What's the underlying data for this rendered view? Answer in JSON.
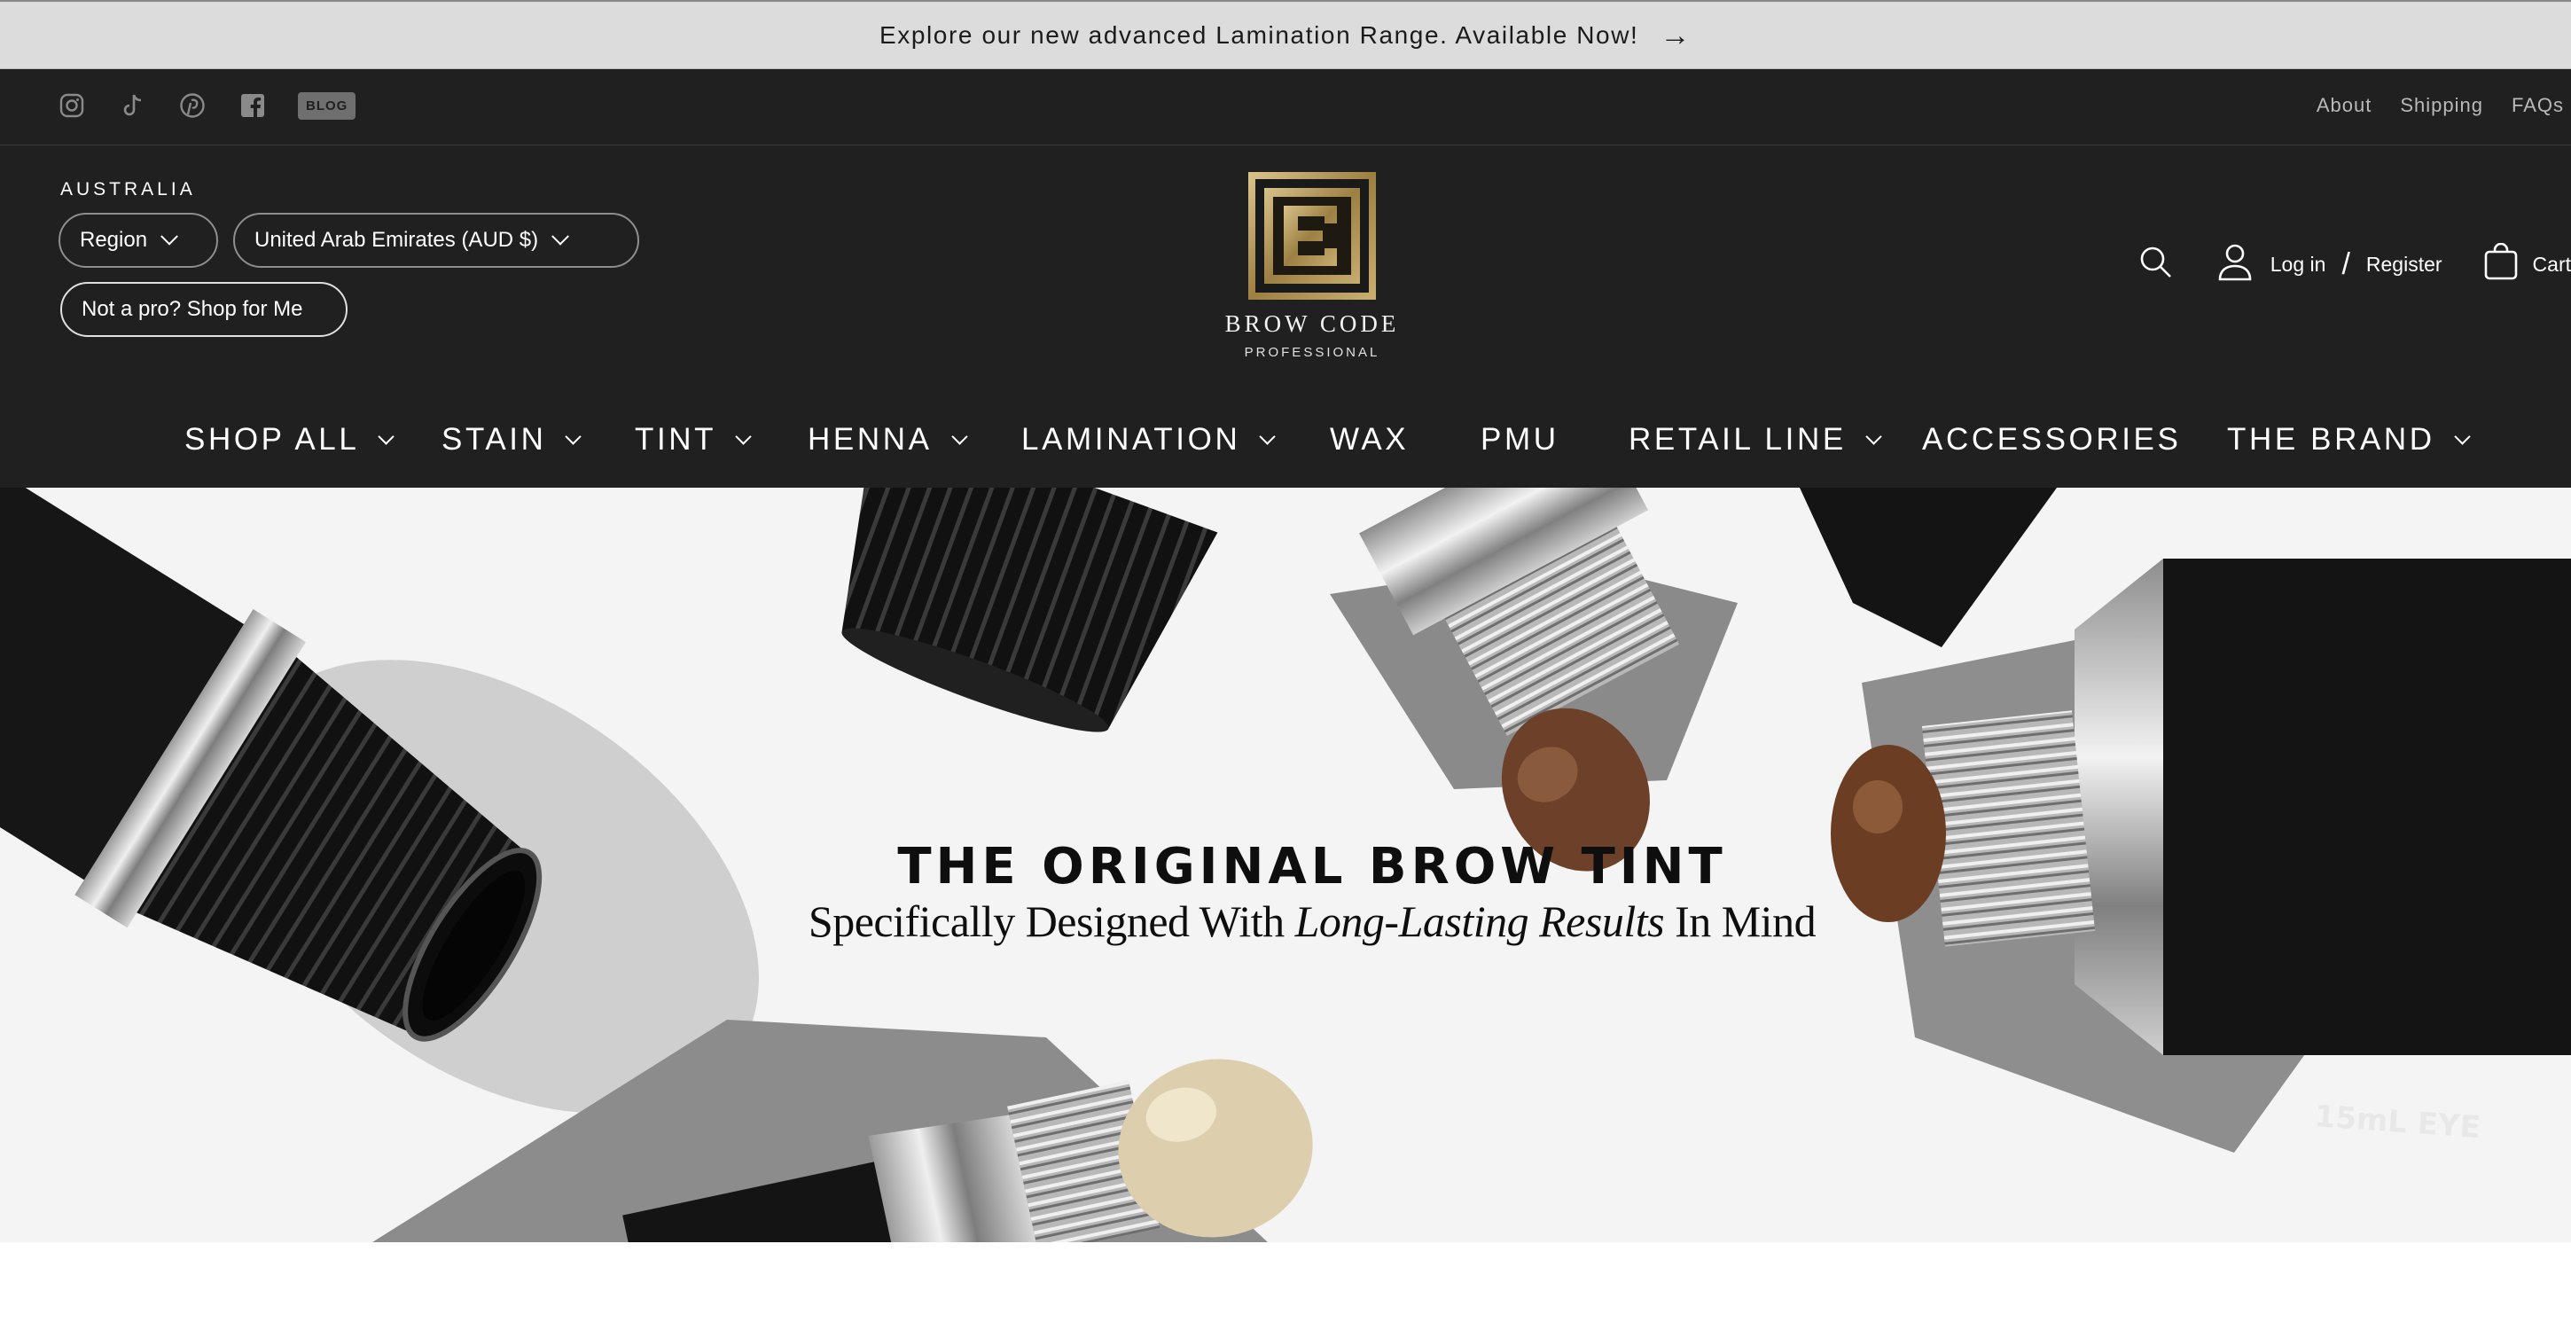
{
  "announcement": {
    "text": "Explore our new advanced Lamination Range. Available Now!",
    "arrow": "→"
  },
  "utility": {
    "social_icons": [
      "instagram-icon",
      "tiktok-icon",
      "pinterest-icon",
      "facebook-icon"
    ],
    "blog_label": "BLOG",
    "links": [
      "About",
      "Shipping",
      "FAQs"
    ]
  },
  "header": {
    "region_label": "AUSTRALIA",
    "region_select": "Region",
    "country_select": "United Arab Emirates (AUD $)",
    "pro_button": "Not a pro? Shop for Me",
    "logo_name": "BROW CODE",
    "logo_sub": "PROFESSIONAL",
    "login": "Log in",
    "separator": "/",
    "register": "Register",
    "cart": "Cart"
  },
  "nav": [
    {
      "label": "SHOP ALL",
      "dropdown": true
    },
    {
      "label": "STAIN",
      "dropdown": true
    },
    {
      "label": "TINT",
      "dropdown": true
    },
    {
      "label": "HENNA",
      "dropdown": true
    },
    {
      "label": "LAMINATION",
      "dropdown": true
    },
    {
      "label": "WAX",
      "dropdown": false
    },
    {
      "label": "PMU",
      "dropdown": false
    },
    {
      "label": "RETAIL LINE",
      "dropdown": true
    },
    {
      "label": "ACCESSORIES",
      "dropdown": false
    },
    {
      "label": "THE BRAND",
      "dropdown": true
    }
  ],
  "hero": {
    "title": "THE ORIGINAL BROW TINT",
    "subtitle_pre": "Specifically Designed With ",
    "subtitle_em": "Long-Lasting Results",
    "subtitle_post": " In Mind",
    "tube_label": "15mL EYE"
  },
  "colors": {
    "announcement_bg": "#dcdcdc",
    "header_bg": "#202020",
    "hero_bg": "#f4f4f4",
    "logo_gold": "#b59a5c"
  }
}
